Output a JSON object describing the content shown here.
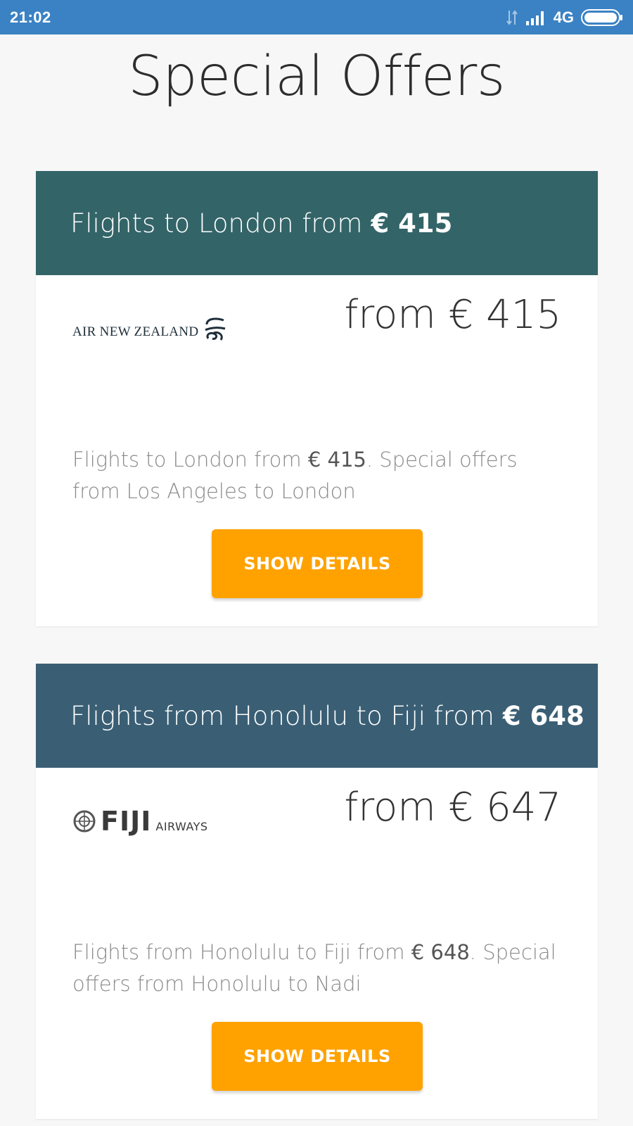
{
  "status_bar": {
    "time": "21:02",
    "network_type": "4G",
    "icons": [
      "network-arrows-icon",
      "signal-icon",
      "battery-icon"
    ]
  },
  "page": {
    "title": "Special Offers"
  },
  "offers": [
    {
      "header_prefix": "Flights to London from",
      "header_price": "€ 415",
      "airline_logo": "AIR NEW ZEALAND",
      "price_prefix": "from",
      "price": "€ 415",
      "description_prefix": "Flights to London from",
      "description_price": "€ 415",
      "description_suffix": ". Special offers from Los Angeles to London",
      "button_label": "SHOW DETAILS",
      "header_color": "#336468"
    },
    {
      "header_prefix": "Flights from Honolulu to Fiji from",
      "header_price": "€ 648",
      "airline_logo": "FIJI",
      "airline_logo_sub": "AIRWAYS",
      "price_prefix": "from",
      "price": "€ 647",
      "description_prefix": "Flights from Honolulu to Fiji from",
      "description_price": "€ 648",
      "description_suffix": ". Special offers from Honolulu to Nadi",
      "button_label": "SHOW DETAILS",
      "header_color": "#3a5f75"
    }
  ],
  "colors": {
    "status_bar": "#3a82c4",
    "button": "#ffa200",
    "background": "#f7f7f7"
  }
}
